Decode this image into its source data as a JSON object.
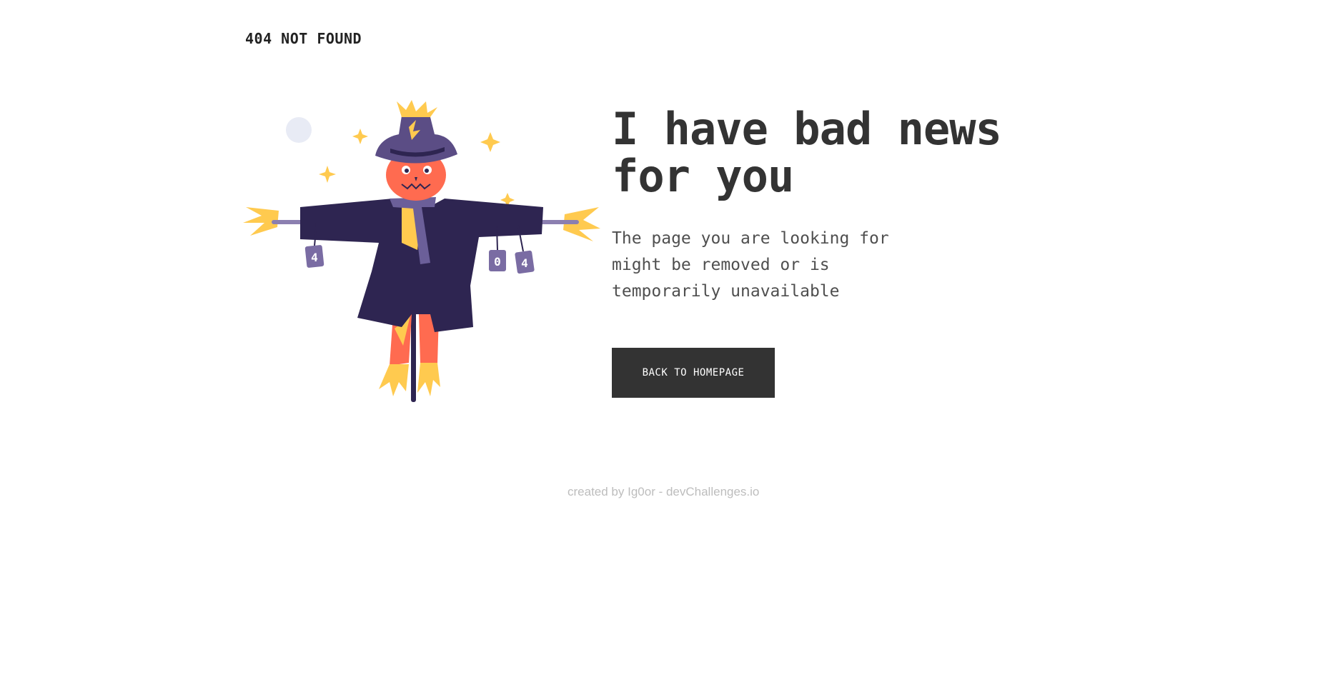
{
  "brand": {
    "title": "404 NOT FOUND"
  },
  "illustration": {
    "name": "scarecrow-illustration",
    "cans": [
      "4",
      "0",
      "4"
    ]
  },
  "main": {
    "headline": "I have bad news for you",
    "message": "The page you are looking for might be removed or is temporarily unavailable",
    "button_label": "BACK TO HOMEPAGE"
  },
  "footer": {
    "credit": "created by Ig0or - devChallenges.io"
  },
  "colors": {
    "text_dark": "#333333",
    "button_bg": "#333333",
    "footer_text": "#bdbdbd",
    "coat": "#2e2551",
    "hat": "#5b4d85",
    "face": "#ff6b50",
    "straw": "#ffca4f",
    "can": "#7a6ca3",
    "moon": "#e8ebf5"
  }
}
